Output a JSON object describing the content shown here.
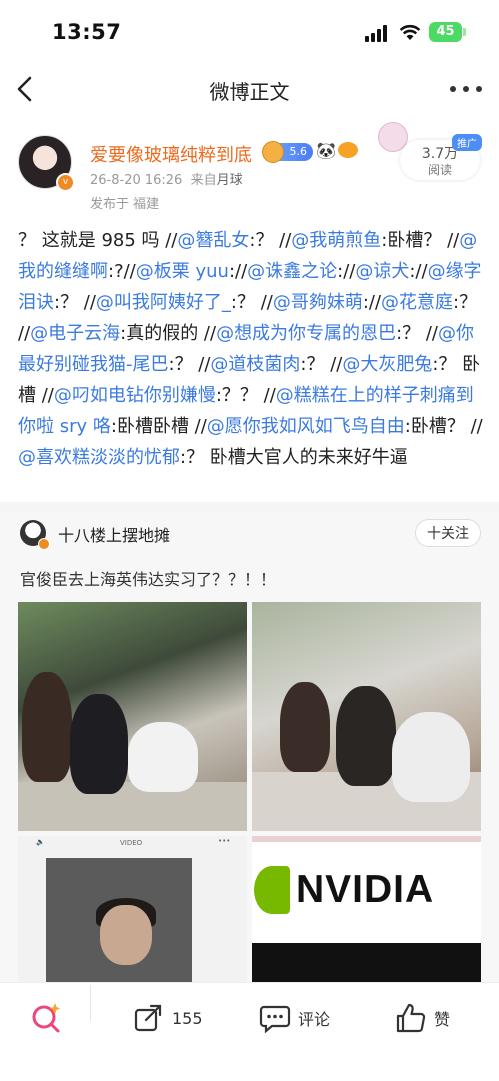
{
  "status_bar": {
    "time": "13:57",
    "battery": "45"
  },
  "nav": {
    "title": "微博正文"
  },
  "post": {
    "author": "爱要像玻璃纯粹到底",
    "level_badge": "5.6",
    "date": "26-8-20 16:26",
    "source_prefix": "来自",
    "source": "月球",
    "location": "发布于 福建",
    "reads_count": "3.7万",
    "reads_label": "阅读",
    "promo_label": "推广",
    "content": [
      {
        "t": "？ 这就是 985 吗 //"
      },
      {
        "t": "@簪乱女",
        "at": true
      },
      {
        "t": ":？ //"
      },
      {
        "t": "@我萌煎鱼",
        "at": true
      },
      {
        "t": ":卧槽？ //"
      },
      {
        "t": "@我的缝缝啊",
        "at": true
      },
      {
        "t": ":?//"
      },
      {
        "t": "@板栗 yuu",
        "at": true
      },
      {
        "t": "://"
      },
      {
        "t": "@诛鑫之论",
        "at": true
      },
      {
        "t": "://"
      },
      {
        "t": "@谅犬",
        "at": true
      },
      {
        "t": "://"
      },
      {
        "t": "@缘字泪诀",
        "at": true
      },
      {
        "t": ":？ //"
      },
      {
        "t": "@叫我阿姨好了_",
        "at": true
      },
      {
        "t": ":？ //"
      },
      {
        "t": "@哥夠妹萌",
        "at": true
      },
      {
        "t": "://"
      },
      {
        "t": "@花意庭",
        "at": true
      },
      {
        "t": ":？ //"
      },
      {
        "t": "@电子云海",
        "at": true
      },
      {
        "t": ":真的假的 //"
      },
      {
        "t": "@想成为你专属的恩巴",
        "at": true
      },
      {
        "t": ":？ //"
      },
      {
        "t": "@你最好别碰我猫-尾巴",
        "at": true
      },
      {
        "t": ":？ //"
      },
      {
        "t": "@道枝菌肉",
        "at": true
      },
      {
        "t": ":？ //"
      },
      {
        "t": "@大灰肥兔",
        "at": true
      },
      {
        "t": ":？ 卧槽 //"
      },
      {
        "t": "@叼如电钻你别嫌慢",
        "at": true
      },
      {
        "t": ":？？ //"
      },
      {
        "t": "@糕糕在上的样子刺痛到你啦 sry 咯",
        "at": true
      },
      {
        "t": ":卧槽卧槽 //"
      },
      {
        "t": "@愿你我如风如飞鸟自由",
        "at": true
      },
      {
        "t": ":卧槽？ //"
      },
      {
        "t": "@喜欢糕淡淡的忧郁",
        "at": true
      },
      {
        "t": ":？ 卧槽大官人的未来好牛逼"
      }
    ]
  },
  "retweet": {
    "author": "十八楼上摆地摊",
    "follow_label": "十关注",
    "text": "官俊臣去上海英伟达实习了？？！！",
    "video_label": "VIDEO",
    "nvidia_text": "NVIDIA"
  },
  "bottom_bar": {
    "repost_count": "155",
    "comment_label": "评论",
    "like_label": "赞"
  }
}
